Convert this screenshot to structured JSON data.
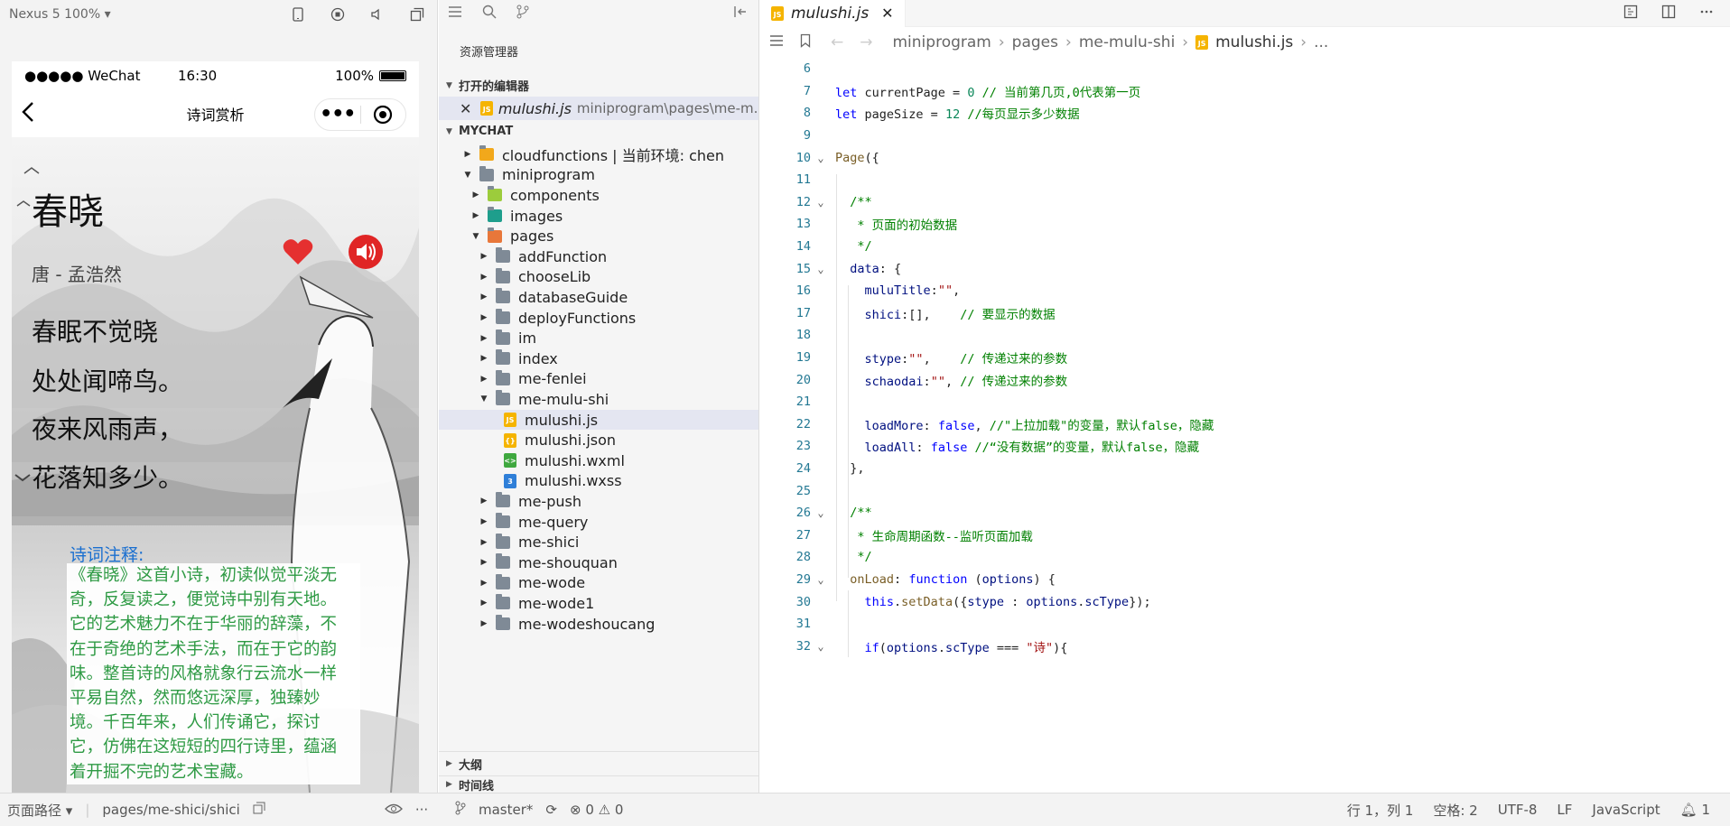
{
  "simulator": {
    "device_label": "Nexus 5 100% ▾",
    "status_bar": {
      "carrier": "●●●●● WeChat",
      "time": "16:30",
      "battery": "100%"
    },
    "nav": {
      "title": "诗词赏析",
      "menu_dots": "•••"
    },
    "poem": {
      "title": "春晓",
      "author": "唐 - 孟浩然",
      "lines": [
        "春眠不觉晓",
        "处处闻啼鸟。",
        "夜来风雨声，",
        "花落知多少。"
      ]
    },
    "notes_label": "诗词注释:",
    "notes_lines": [
      "《春晓》这首小诗，初读似觉平淡无",
      "奇，反复读之，便觉诗中别有天地。",
      "它的艺术魅力不在于华丽的辞藻，不",
      "在于奇绝的艺术手法，而在于它的韵",
      "味。整首诗的风格就象行云流水一样",
      "平易自然，然而悠远深厚，独臻妙",
      "境。千百年来，人们传诵它，探讨",
      "它，仿佛在这短短的四行诗里，蕴涵",
      "着开掘不完的艺术宝藏。"
    ]
  },
  "explorer": {
    "title": "资源管理器",
    "open_editors_label": "打开的编辑器",
    "open_editor": {
      "file": "mulushi.js",
      "path": "miniprogram\\pages\\me-m..."
    },
    "workspace_label": "MYCHAT",
    "tree": [
      {
        "label": "cloudfunctions | 当前环境: chen",
        "depth": 0,
        "arrow": "▶",
        "icon": "cloud-folder"
      },
      {
        "label": "miniprogram",
        "depth": 0,
        "arrow": "▼",
        "icon": "folder"
      },
      {
        "label": "components",
        "depth": 1,
        "arrow": "▶",
        "icon": "components-folder"
      },
      {
        "label": "images",
        "depth": 1,
        "arrow": "▶",
        "icon": "images-folder"
      },
      {
        "label": "pages",
        "depth": 1,
        "arrow": "▼",
        "icon": "pages-folder"
      },
      {
        "label": "addFunction",
        "depth": 2,
        "arrow": "▶",
        "icon": "folder"
      },
      {
        "label": "chooseLib",
        "depth": 2,
        "arrow": "▶",
        "icon": "folder"
      },
      {
        "label": "databaseGuide",
        "depth": 2,
        "arrow": "▶",
        "icon": "folder"
      },
      {
        "label": "deployFunctions",
        "depth": 2,
        "arrow": "▶",
        "icon": "folder"
      },
      {
        "label": "im",
        "depth": 2,
        "arrow": "▶",
        "icon": "folder"
      },
      {
        "label": "index",
        "depth": 2,
        "arrow": "▶",
        "icon": "folder"
      },
      {
        "label": "me-fenlei",
        "depth": 2,
        "arrow": "▶",
        "icon": "folder"
      },
      {
        "label": "me-mulu-shi",
        "depth": 2,
        "arrow": "▼",
        "icon": "folder"
      },
      {
        "label": "mulushi.js",
        "depth": 3,
        "arrow": "",
        "icon": "js-file",
        "selected": true
      },
      {
        "label": "mulushi.json",
        "depth": 3,
        "arrow": "",
        "icon": "json-file"
      },
      {
        "label": "mulushi.wxml",
        "depth": 3,
        "arrow": "",
        "icon": "wxml-file"
      },
      {
        "label": "mulushi.wxss",
        "depth": 3,
        "arrow": "",
        "icon": "wxss-file"
      },
      {
        "label": "me-push",
        "depth": 2,
        "arrow": "▶",
        "icon": "folder"
      },
      {
        "label": "me-query",
        "depth": 2,
        "arrow": "▶",
        "icon": "folder"
      },
      {
        "label": "me-shici",
        "depth": 2,
        "arrow": "▶",
        "icon": "folder"
      },
      {
        "label": "me-shouquan",
        "depth": 2,
        "arrow": "▶",
        "icon": "folder"
      },
      {
        "label": "me-wode",
        "depth": 2,
        "arrow": "▶",
        "icon": "folder"
      },
      {
        "label": "me-wode1",
        "depth": 2,
        "arrow": "▶",
        "icon": "folder"
      },
      {
        "label": "me-wodeshoucang",
        "depth": 2,
        "arrow": "▶",
        "icon": "folder"
      }
    ],
    "outline_label": "大纲",
    "timeline_label": "时间线"
  },
  "editor": {
    "tab_label": "mulushi.js",
    "breadcrumb": [
      "miniprogram",
      "pages",
      "me-mulu-shi",
      "mulushi.js",
      "..."
    ],
    "code_lines": [
      {
        "n": "6",
        "fold": "",
        "html": ""
      },
      {
        "n": "7",
        "fold": "",
        "html": "<span class=\"kw\">let</span> currentPage = <span class=\"num\">0</span> <span class=\"cm\">// 当前第几页,0代表第一页</span>"
      },
      {
        "n": "8",
        "fold": "",
        "html": "<span class=\"kw\">let</span> pageSize = <span class=\"num\">12</span> <span class=\"cm\">//每页显示多少数据</span>"
      },
      {
        "n": "9",
        "fold": "",
        "html": ""
      },
      {
        "n": "10",
        "fold": "⌄",
        "html": "<span class=\"fn\">Page</span>({"
      },
      {
        "n": "11",
        "fold": "",
        "html": ""
      },
      {
        "n": "12",
        "fold": "⌄",
        "html": "  <span class=\"cm\">/**</span>"
      },
      {
        "n": "13",
        "fold": "",
        "html": "   <span class=\"cm\">* 页面的初始数据</span>"
      },
      {
        "n": "14",
        "fold": "",
        "html": "   <span class=\"cm\">*/</span>"
      },
      {
        "n": "15",
        "fold": "⌄",
        "html": "  <span class=\"prop\">data</span>: {"
      },
      {
        "n": "16",
        "fold": "",
        "html": "    <span class=\"prop\">muluTitle</span>:<span class=\"str\">\"\"</span>,"
      },
      {
        "n": "17",
        "fold": "",
        "html": "    <span class=\"prop\">shici</span>:[],    <span class=\"cm\">// 要显示的数据</span>"
      },
      {
        "n": "18",
        "fold": "",
        "html": ""
      },
      {
        "n": "19",
        "fold": "",
        "html": "    <span class=\"prop\">stype</span>:<span class=\"str\">\"\"</span>,    <span class=\"cm\">// 传递过来的参数</span>"
      },
      {
        "n": "20",
        "fold": "",
        "html": "    <span class=\"prop\">schaodai</span>:<span class=\"str\">\"\"</span>, <span class=\"cm\">// 传递过来的参数</span>"
      },
      {
        "n": "21",
        "fold": "",
        "html": ""
      },
      {
        "n": "22",
        "fold": "",
        "html": "    <span class=\"prop\">loadMore</span>: <span class=\"kw\">false</span>, <span class=\"cm\">//\"上拉加载\"的变量，默认false，隐藏</span>"
      },
      {
        "n": "23",
        "fold": "",
        "html": "    <span class=\"prop\">loadAll</span>: <span class=\"kw\">false</span> <span class=\"cm\">//“没有数据”的变量，默认false，隐藏</span>"
      },
      {
        "n": "24",
        "fold": "",
        "html": "  },"
      },
      {
        "n": "25",
        "fold": "",
        "html": ""
      },
      {
        "n": "26",
        "fold": "⌄",
        "html": "  <span class=\"cm\">/**</span>"
      },
      {
        "n": "27",
        "fold": "",
        "html": "   <span class=\"cm\">* 生命周期函数--监听页面加载</span>"
      },
      {
        "n": "28",
        "fold": "",
        "html": "   <span class=\"cm\">*/</span>"
      },
      {
        "n": "29",
        "fold": "⌄",
        "html": "  <span class=\"fn\">onLoad</span>: <span class=\"kw\">function</span> (<span class=\"prop\">options</span>) {"
      },
      {
        "n": "30",
        "fold": "",
        "html": "    <span class=\"kw\">this</span>.<span class=\"fn\">setData</span>({<span class=\"prop\">stype</span> : <span class=\"prop\">options</span>.<span class=\"prop\">scType</span>});"
      },
      {
        "n": "31",
        "fold": "",
        "html": ""
      },
      {
        "n": "32",
        "fold": "⌄",
        "html": "    <span class=\"kw\">if</span>(<span class=\"prop\">options</span>.<span class=\"prop\">scType</span> === <span class=\"str\">\"诗\"</span>){"
      }
    ]
  },
  "statusbar": {
    "page_path_label": "页面路径 ▾",
    "page_path": "pages/me-shici/shici",
    "branch": "master*",
    "problems": "⊗ 0 ⚠ 0",
    "cursor": "行 1，列 1",
    "spaces": "空格: 2",
    "encoding": "UTF-8",
    "eol": "LF",
    "language": "JavaScript",
    "notifications": "1"
  },
  "colors": {
    "accent_blue": "#1a6fd0",
    "notes_green": "#2e9a44",
    "heart_red": "#e53030"
  }
}
